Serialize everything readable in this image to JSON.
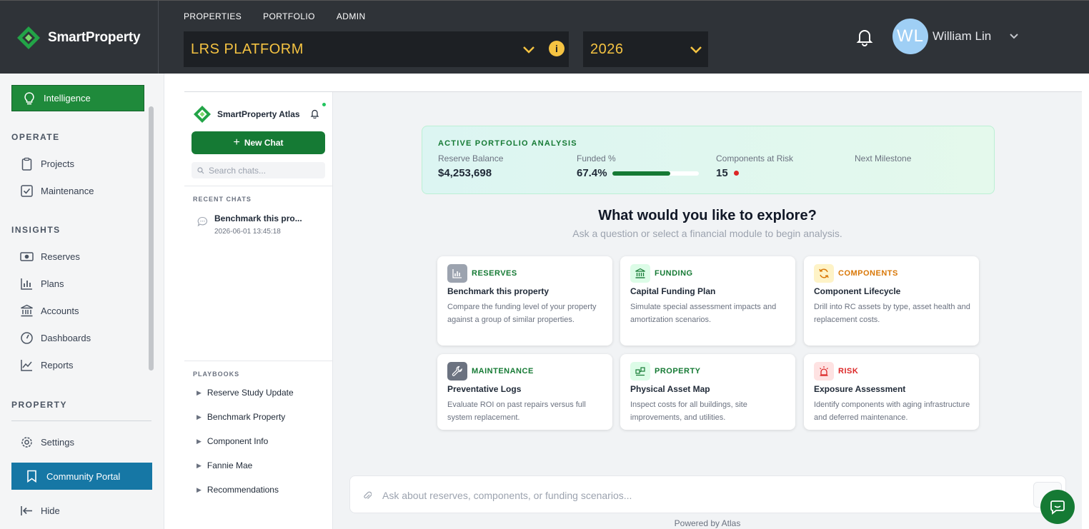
{
  "app": {
    "name": "SmartProperty"
  },
  "topnav": [
    "PROPERTIES",
    "PORTFOLIO",
    "ADMIN"
  ],
  "platform_select": {
    "value": "LRS PLATFORM"
  },
  "year_select": {
    "value": "2026"
  },
  "user": {
    "initials": "WL",
    "name": "William Lin"
  },
  "sidebar": {
    "active": "Intelligence",
    "sections": {
      "operate": "OPERATE",
      "insights": "INSIGHTS",
      "property": "PROPERTY"
    },
    "operate_items": [
      "Projects",
      "Maintenance"
    ],
    "insights_items": [
      "Reserves",
      "Plans",
      "Accounts",
      "Dashboards",
      "Reports"
    ],
    "settings": "Settings",
    "portal": "Community Portal",
    "hide": "Hide"
  },
  "chat_panel": {
    "title": "SmartProperty Atlas",
    "new_chat": "New Chat",
    "search_placeholder": "Search chats...",
    "recent_label": "RECENT CHATS",
    "recent": [
      {
        "title": "Benchmark this pro...",
        "date": "2026-06-01 13:45:18"
      }
    ],
    "playbooks_label": "PLAYBOOKS",
    "playbooks": [
      "Reserve Study Update",
      "Benchmark Property",
      "Component Info",
      "Fannie Mae",
      "Recommendations"
    ]
  },
  "analysis": {
    "title": "ACTIVE PORTFOLIO ANALYSIS",
    "reserve_label": "Reserve Balance",
    "reserve_value": "$4,253,698",
    "funded_label": "Funded %",
    "funded_value": "67.4%",
    "funded_fraction": 0.674,
    "risk_label": "Components at Risk",
    "risk_value": "15",
    "milestone_label": "Next Milestone"
  },
  "explore": {
    "title": "What would you like to explore?",
    "subtitle": "Ask a question or select a financial module to begin analysis."
  },
  "cards": [
    {
      "category": "RESERVES",
      "title": "Benchmark this property",
      "desc": "Compare the funding level of your property against a group of similar properties.",
      "color": "#157a34",
      "icon": "bar-chart-icon"
    },
    {
      "category": "FUNDING",
      "title": "Capital Funding Plan",
      "desc": "Simulate special assessment impacts and amortization scenarios.",
      "color": "#157a34",
      "icon": "bank-icon"
    },
    {
      "category": "COMPONENTS",
      "title": "Component Lifecycle",
      "desc": "Drill into RC assets by type, asset health and replacement costs.",
      "color": "#d97706",
      "icon": "cycle-icon"
    },
    {
      "category": "MAINTENANCE",
      "title": "Preventative Logs",
      "desc": "Evaluate ROI on past repairs versus full system replacement.",
      "color": "#157a34",
      "icon": "wrench-icon"
    },
    {
      "category": "PROPERTY",
      "title": "Physical Asset Map",
      "desc": "Inspect costs for all buildings, site improvements, and utilities.",
      "color": "#157a34",
      "icon": "map-icon"
    },
    {
      "category": "RISK",
      "title": "Exposure Assessment",
      "desc": "Identify components with aging infrastructure and deferred maintenance.",
      "color": "#dc2626",
      "icon": "alarm-icon"
    }
  ],
  "input": {
    "placeholder": "Ask about reserves, components, or funding scenarios..."
  },
  "footer": {
    "powered": "Powered by Atlas"
  }
}
